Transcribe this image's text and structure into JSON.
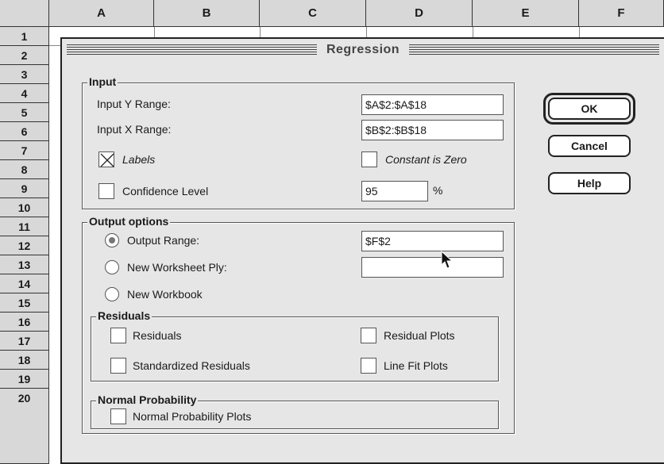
{
  "spreadsheet": {
    "columns": [
      "A",
      "B",
      "C",
      "D",
      "E",
      "F"
    ],
    "rows": [
      "1",
      "2",
      "3",
      "4",
      "5",
      "6",
      "7",
      "8",
      "9",
      "10",
      "11",
      "12",
      "13",
      "14",
      "15",
      "16",
      "17",
      "18",
      "19",
      "20"
    ]
  },
  "dialog": {
    "title": "Regression",
    "input": {
      "legend": "Input",
      "y_range_label": "Input Y Range:",
      "y_range_value": "$A$2:$A$18",
      "x_range_label": "Input X Range:",
      "x_range_value": "$B$2:$B$18",
      "labels_label": "Labels",
      "labels_checked": true,
      "constant_zero_label": "Constant is Zero",
      "constant_zero_checked": false,
      "confidence_label": "Confidence Level",
      "confidence_checked": false,
      "confidence_value": "95",
      "percent_sign": "%"
    },
    "output": {
      "legend": "Output options",
      "output_range_label": "Output Range:",
      "output_range_value": "$F$2",
      "new_ply_label": "New Worksheet Ply:",
      "new_ply_value": "",
      "new_workbook_label": "New Workbook",
      "selected": "Output Range"
    },
    "residuals": {
      "legend": "Residuals",
      "residuals_label": "Residuals",
      "residual_plots_label": "Residual Plots",
      "standardized_label": "Standardized Residuals",
      "line_fit_label": "Line Fit Plots"
    },
    "normal": {
      "legend": "Normal Probability",
      "plots_label": "Normal Probability Plots"
    },
    "buttons": {
      "ok": "OK",
      "cancel": "Cancel",
      "help": "Help"
    }
  }
}
